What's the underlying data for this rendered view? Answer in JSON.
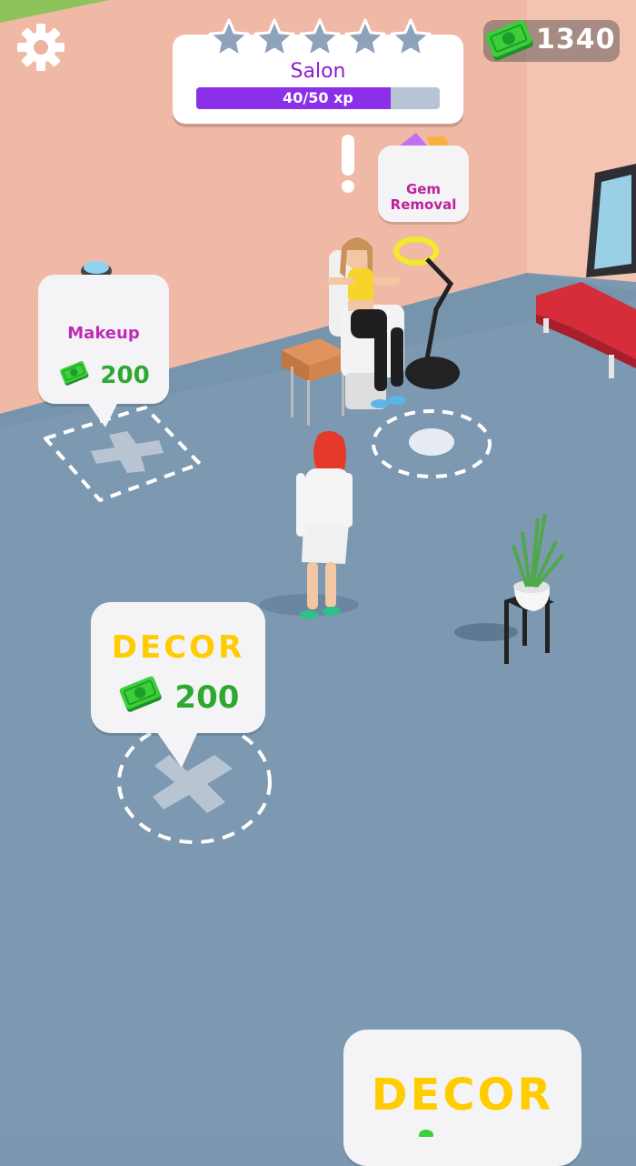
{
  "hud": {
    "settings_icon": "gear-icon",
    "cash_icon": "cash-icon",
    "cash_amount": "1340"
  },
  "level": {
    "title": "Salon",
    "xp_text": "40/50 xp",
    "xp_progress": 0.8,
    "stars_total": 5,
    "stars_filled": 0
  },
  "stations": {
    "makeup": {
      "label": "Makeup",
      "price": "200"
    },
    "gem_removal": {
      "label_line1": "Gem",
      "label_line2": "Removal"
    },
    "decor_1": {
      "title": "DECOR",
      "price": "200"
    },
    "decor_2": {
      "title": "DECOR"
    }
  },
  "colors": {
    "floor": "#7b98b0",
    "wall": "#f0b8a4",
    "xp_fill": "#8b2fe8",
    "decor_text": "#ffcc00",
    "price_green": "#2fa82f",
    "station_pink": "#c02ab8"
  }
}
